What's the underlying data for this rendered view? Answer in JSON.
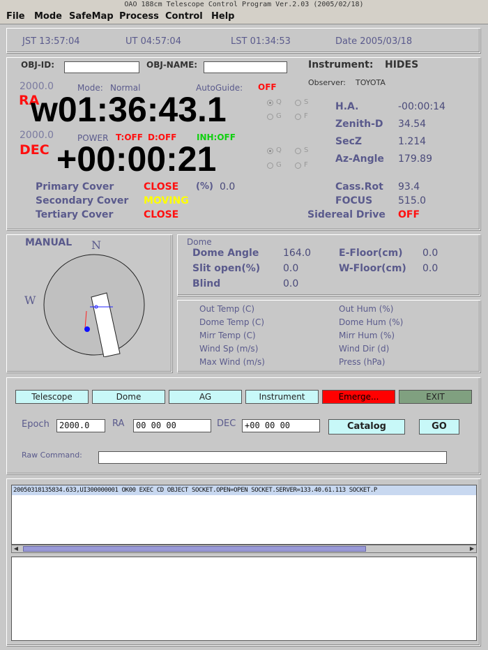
{
  "window": {
    "title": "OAO 188cm Telescope Control Program Ver.2.03 (2005/02/18)"
  },
  "menu": [
    "File",
    "Mode",
    "SafeMap",
    "Process",
    "Control",
    "Help"
  ],
  "time": {
    "jst": "JST  13:57:04",
    "ut": "UT   04:57:04",
    "lst": "LST  01:34:53",
    "date": "Date 2005/03/18"
  },
  "obj": {
    "id_label": "OBJ-ID:",
    "id_value": "",
    "name_label": "OBJ-NAME:",
    "name_value": ""
  },
  "instrument": {
    "label": "Instrument:",
    "value": "HIDES",
    "observer_label": "Observer:",
    "observer_value": "TOYOTA"
  },
  "ra": {
    "epoch": "2000.0",
    "label": "RA",
    "value": "w01:36:43.1",
    "mode_label": "Mode:",
    "mode_value": "Normal",
    "autoguide_label": "AutoGuide:",
    "autoguide_value": "OFF"
  },
  "dec": {
    "epoch": "2000.0",
    "label": "DEC",
    "value": "+00:00:21",
    "power_label": "POWER",
    "t_status": "T:OFF",
    "d_status": "D:OFF",
    "inh_status": "INH:OFF"
  },
  "radios": {
    "q": "Q",
    "s": "S",
    "g": "G",
    "f": "F"
  },
  "position": {
    "ha_label": "H.A.",
    "ha_value": "-00:00:14",
    "zenith_label": "Zenith-D",
    "zenith_value": "34.54",
    "secz_label": "SecZ",
    "secz_value": "1.214",
    "az_label": "Az-Angle",
    "az_value": "179.89"
  },
  "covers": {
    "primary_label": "Primary Cover",
    "primary_value": "CLOSE",
    "pct_label": "(%)",
    "pct_value": "0.0",
    "secondary_label": "Secondary Cover",
    "secondary_value": "MOVING",
    "tertiary_label": "Tertiary Cover",
    "tertiary_value": "CLOSE"
  },
  "drive": {
    "cass_label": "Cass.Rot",
    "cass_value": "93.4",
    "focus_label": "FOCUS",
    "focus_value": "515.0",
    "sidereal_label": "Sidereal Drive",
    "sidereal_value": "OFF"
  },
  "map": {
    "mode": "MANUAL",
    "north": "N",
    "west": "W"
  },
  "dome": {
    "title": "Dome",
    "angle_label": "Dome Angle",
    "angle_value": "164.0",
    "slit_label": "Slit open(%)",
    "slit_value": "0.0",
    "blind_label": "Blind",
    "blind_value": "0.0",
    "efloor_label": "E-Floor(cm)",
    "efloor_value": "0.0",
    "wfloor_label": "W-Floor(cm)",
    "wfloor_value": "0.0"
  },
  "weather": {
    "out_temp": "Out Temp (C)",
    "dome_temp": "Dome Temp (C)",
    "mirr_temp": "Mirr Temp (C)",
    "wind_sp": "Wind Sp (m/s)",
    "max_wind": "Max Wind (m/s)",
    "out_hum": "Out Hum (%)",
    "dome_hum": "Dome Hum (%)",
    "mirr_hum": "Mirr Hum (%)",
    "wind_dir": "Wind Dir (d)",
    "press": "Press (hPa)"
  },
  "buttons": {
    "telescope": "Telescope",
    "dome": "Dome",
    "ag": "AG",
    "instrument": "Instrument",
    "emergency": "Emerge...",
    "exit": "EXIT"
  },
  "goto": {
    "epoch_label": "Epoch",
    "epoch_value": "2000.0",
    "ra_label": "RA",
    "ra_value": "00 00 00",
    "dec_label": "DEC",
    "dec_value": "+00 00 00",
    "catalog": "Catalog",
    "go": "GO"
  },
  "raw": {
    "label": "Raw Command:",
    "value": ""
  },
  "log": {
    "line": "20050318135834.633,UI300000001 OK00 EXEC CD OBJECT SOCKET.OPEN=OPEN SOCKET.SERVER=133.40.61.113 SOCKET.P"
  }
}
